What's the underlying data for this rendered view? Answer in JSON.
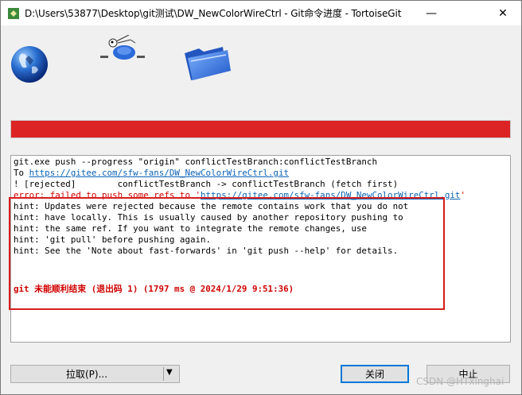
{
  "window": {
    "title": "D:\\Users\\53877\\Desktop\\git测试\\DW_NewColorWireCtrl - Git命令进度 - TortoiseGit",
    "minimize_glyph": "—",
    "close_glyph": "✕"
  },
  "icons": {
    "app": "tortoisegit-icon",
    "globe": "globe-icon",
    "turtle": "turtle-icon",
    "folder": "folder-icon"
  },
  "progress": {
    "percent": 100,
    "color": "#dc2424"
  },
  "log": {
    "line1": "git.exe push --progress \"origin\" conflictTestBranch:conflictTestBranch",
    "line2_prefix": "To ",
    "line2_link": "https://gitee.com/sfw-fans/DW_NewColorWireCtrl.git",
    "line3": "! [rejected]        conflictTestBranch -> conflictTestBranch (fetch first)",
    "line4_prefix": "error: failed to push some refs to '",
    "line4_link": "https://gitee.com/sfw-fans/DW_NewColorWireCtrl.git",
    "line4_suffix": "'",
    "hint1": "hint: Updates were rejected because the remote contains work that you do not",
    "hint2": "hint: have locally. This is usually caused by another repository pushing to",
    "hint3": "hint: the same ref. If you want to integrate the remote changes, use",
    "hint4": "hint: 'git pull' before pushing again.",
    "hint5": "hint: See the 'Note about fast-forwards' in 'git push --help' for details.",
    "finish": "git 未能顺利结束 (退出码 1) (1797 ms @ 2024/1/29 9:51:36)"
  },
  "buttons": {
    "pull": "拉取(P)...",
    "pull_arrow": "▼",
    "close": "关闭",
    "abort": "中止"
  },
  "watermark": "CSDN @HTxinghai",
  "colors": {
    "link": "#0b63b5",
    "error": "#d00000",
    "highlight_box": "#d61d1d"
  }
}
